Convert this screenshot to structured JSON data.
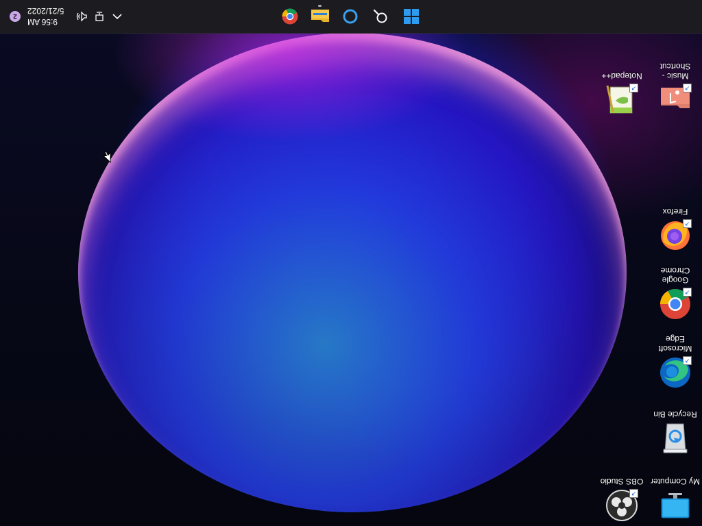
{
  "desktop": {
    "icons": [
      {
        "label": "My Computer"
      },
      {
        "label": "OBS Studio"
      },
      {
        "label": "Recycle Bin"
      },
      {
        "label": "Microsoft Edge"
      },
      {
        "label": "Google Chrome"
      },
      {
        "label": "Firefox"
      },
      {
        "label": "Music - Shortcut"
      },
      {
        "label": "Notepad++"
      }
    ]
  },
  "taskbar": {
    "apps": [
      {
        "name": "start-icon"
      },
      {
        "name": "search-icon"
      },
      {
        "name": "cortana-icon"
      },
      {
        "name": "file-explorer-icon"
      },
      {
        "name": "chrome-icon"
      }
    ],
    "tray": {
      "time": "9:56 AM",
      "date": "5/21/2022",
      "notification_count": "2"
    }
  },
  "colors": {
    "taskbar_bg": "#1c1c20",
    "accent": "#2d9cf0"
  }
}
